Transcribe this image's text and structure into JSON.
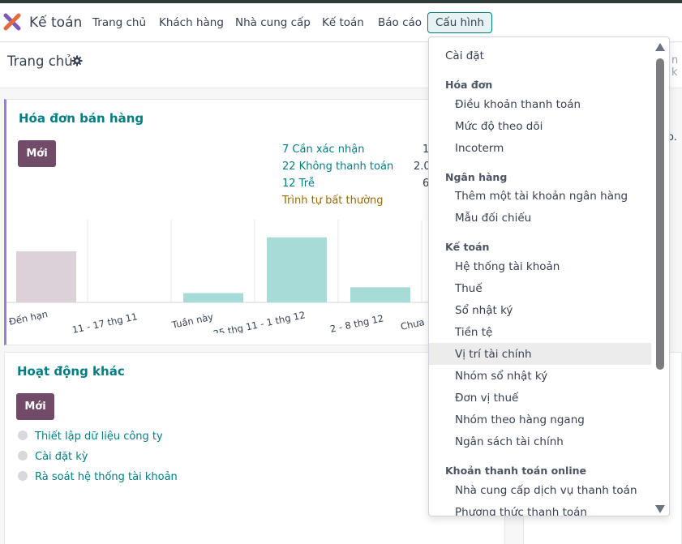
{
  "navbar": {
    "app_name": "Kế toán",
    "menu": [
      "Trang chủ",
      "Khách hàng",
      "Nhà cung cấp",
      "Kế toán",
      "Báo cáo",
      "Cấu hình"
    ]
  },
  "breadcrumb": {
    "title": "Trang chủ",
    "search_fragment": "n k"
  },
  "sales_card": {
    "title": "Hóa đơn bán hàng",
    "new_label": "Mới",
    "stats": [
      {
        "label": "7 Cần xác nhận",
        "value": "1"
      },
      {
        "label": "22 Không thanh toán",
        "value": "2.0"
      },
      {
        "label": "12 Trễ",
        "value": "6"
      },
      {
        "label": "Trình tự bất thường",
        "value": ""
      }
    ]
  },
  "other_card": {
    "title": "Hoạt động khác",
    "new_label": "Mới",
    "activities": [
      "Thiết lập dữ liệu công ty",
      "Cài đặt kỳ",
      "Rà soát hệ thống tài khoản"
    ]
  },
  "side_fragment": "o.",
  "dropdown": {
    "settings": "Cài đặt",
    "sections": [
      {
        "header": "Hóa đơn",
        "items": [
          "Điều khoản thanh toán",
          "Mức độ theo dõi",
          "Incoterm"
        ]
      },
      {
        "header": "Ngân hàng",
        "items": [
          "Thêm một tài khoản ngân hàng",
          "Mẫu đối chiếu"
        ]
      },
      {
        "header": "Kế toán",
        "items": [
          "Hệ thống tài khoản",
          "Thuế",
          "Sổ nhật ký",
          "Tiền tệ",
          "Vị trí tài chính",
          "Nhóm sổ nhật ký",
          "Đơn vị thuế",
          "Nhóm theo hàng ngang",
          "Ngân sách tài chính"
        ]
      },
      {
        "header": "Khoản thanh toán online",
        "items": [
          "Nhà cung cấp dịch vụ thanh toán",
          "Phương thức thanh toán"
        ]
      }
    ],
    "highlighted": "Vị trí tài chính"
  },
  "chart_data": {
    "type": "bar",
    "categories": [
      "Đến hạn",
      "11 - 17 thg 11",
      "Tuần này",
      "25 thg 11 - 1 thg 12",
      "2 - 8 thg 12",
      "Chưa"
    ],
    "values": [
      44,
      0,
      8,
      56,
      13,
      0
    ],
    "colors": [
      "#dcd0d9",
      "#a7dbd8",
      "#a7dbd8",
      "#a7dbd8",
      "#a7dbd8",
      "#a7dbd8"
    ]
  },
  "colors": {
    "accent": "#017e84",
    "primary_button": "#714b67",
    "card_border": "#9b7fd6"
  },
  "icons": {
    "breadcrumb_gear": "gear-icon",
    "app": "odoo-accounting-logo"
  }
}
